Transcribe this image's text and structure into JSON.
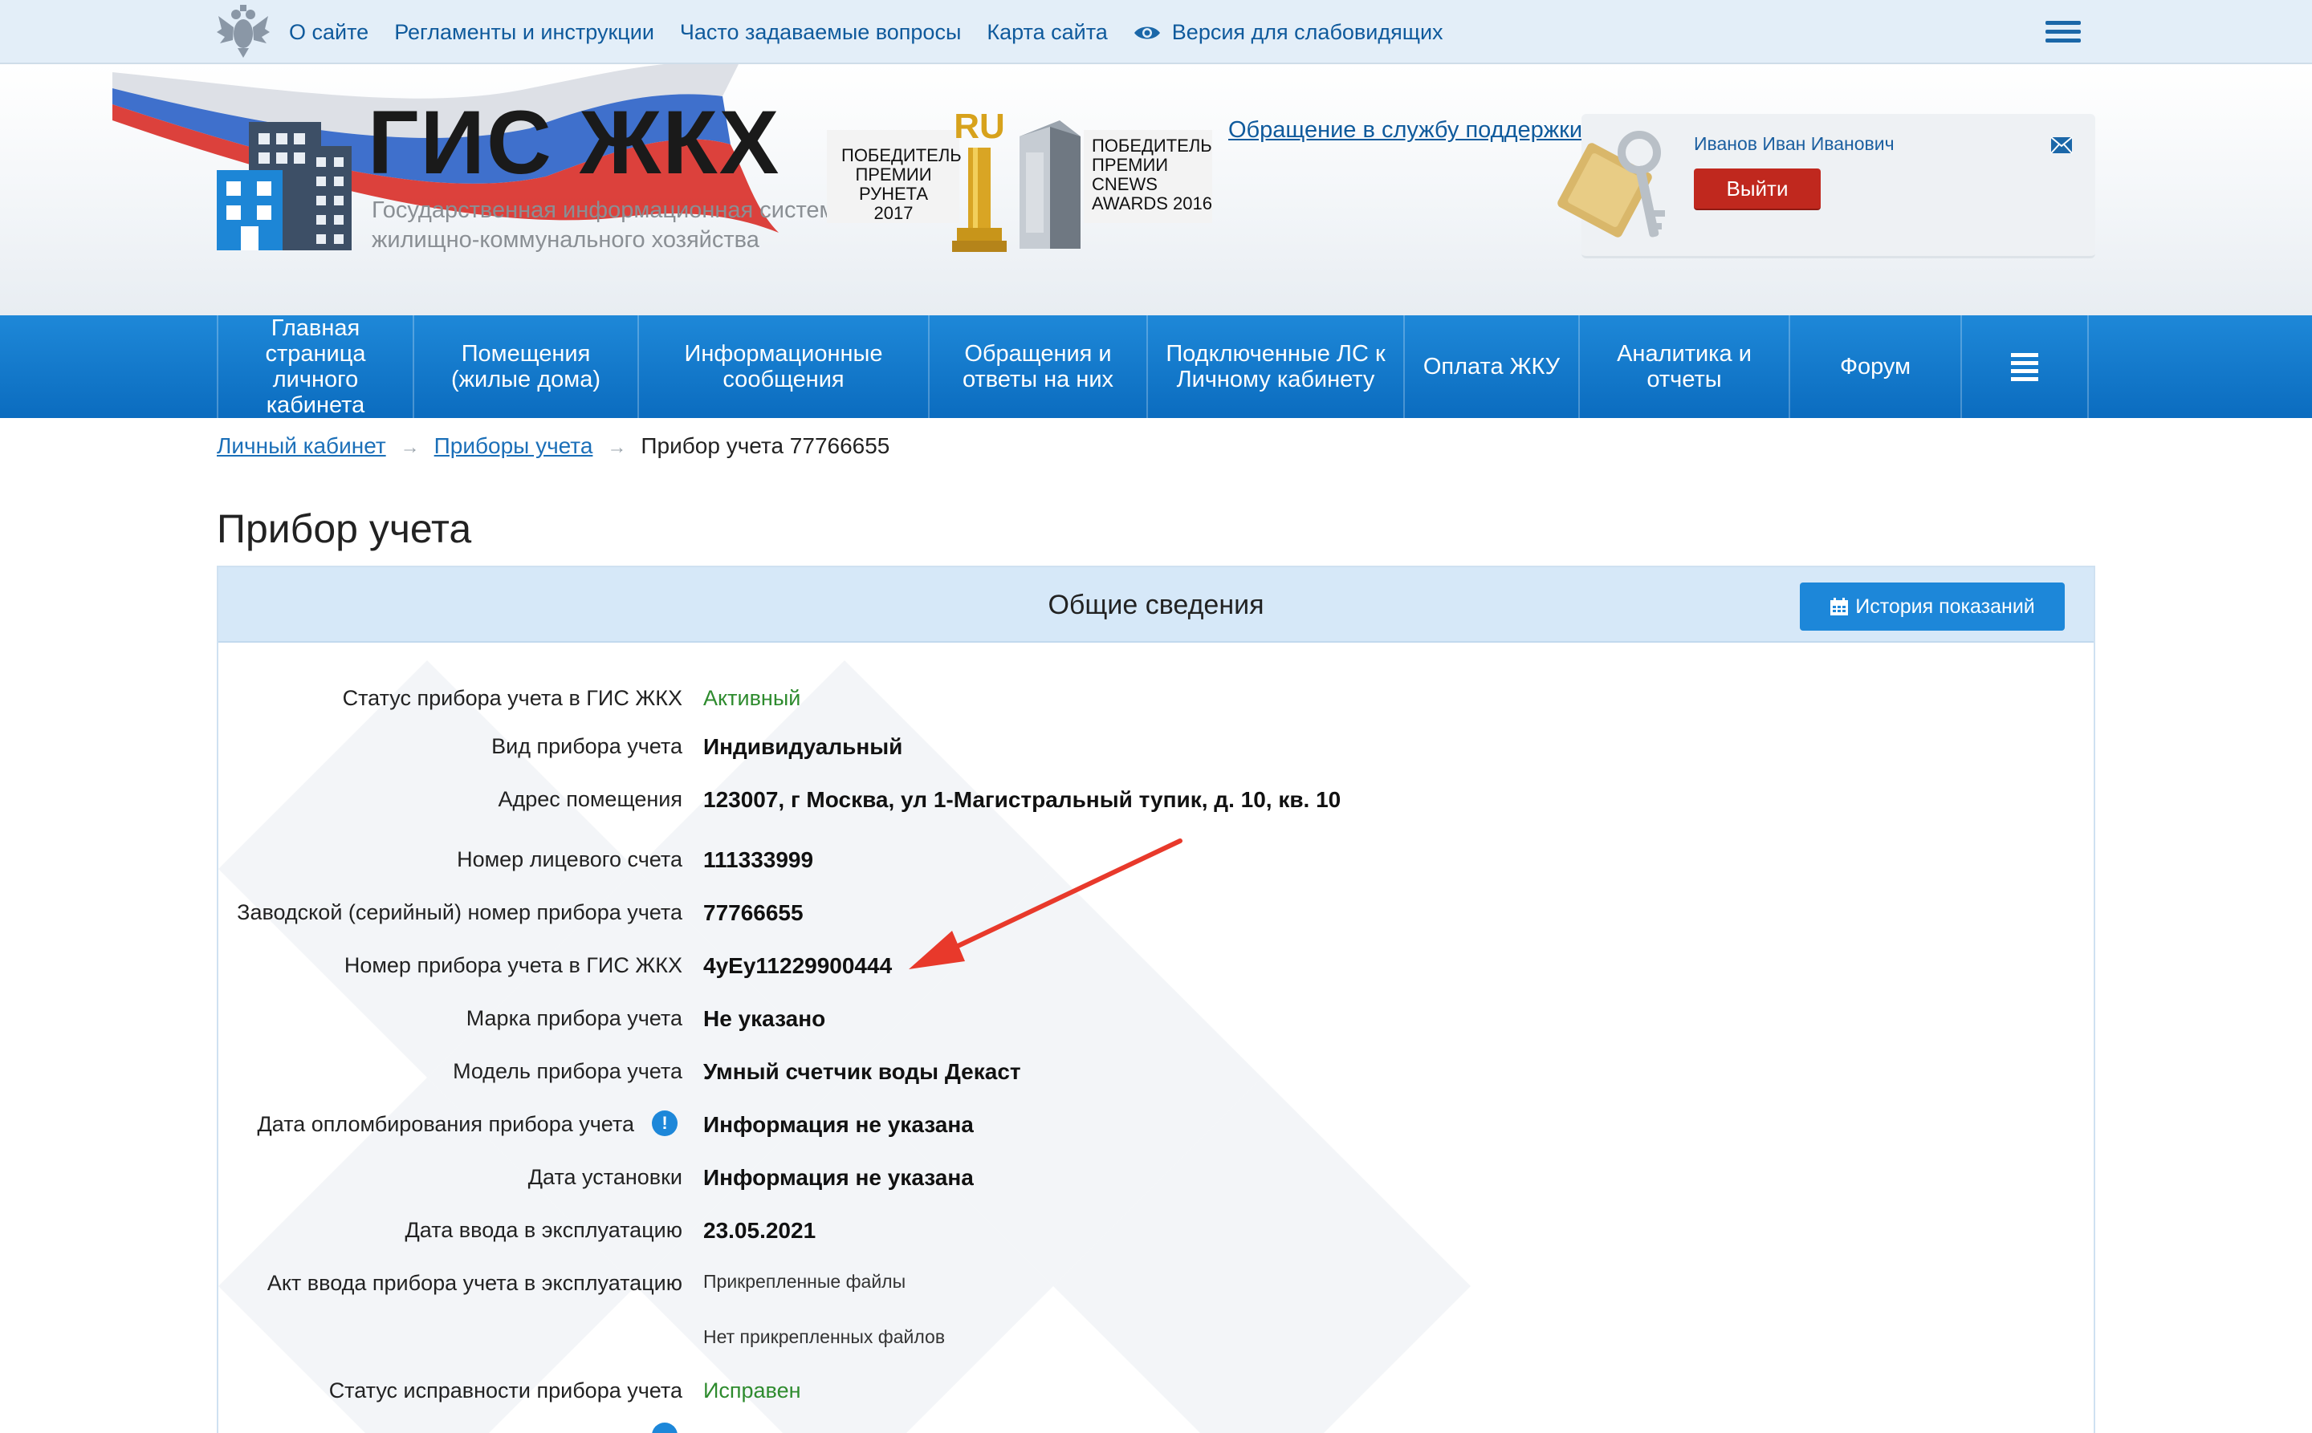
{
  "topbar": {
    "links": [
      "О сайте",
      "Регламенты и инструкции",
      "Часто задаваемые вопросы",
      "Карта сайта"
    ],
    "accessibility": "Версия для слабовидящих"
  },
  "header": {
    "logo_title": "ГИС ЖКХ",
    "logo_subtitle_line1": "Государственная информационная система",
    "logo_subtitle_line2": "жилищно-коммунального хозяйства",
    "award1_lines": [
      "ПОБЕДИТЕЛЬ",
      "ПРЕМИИ",
      "РУНЕТА 2017"
    ],
    "award2_lines": [
      "ПОБЕДИТЕЛЬ",
      "ПРЕМИИ",
      "CNEWS",
      "AWARDS 2016"
    ],
    "award_logo_text": "RU",
    "support_link": "Обращение в службу поддержки",
    "user_name": "Иванов Иван Иванович",
    "logout_label": "Выйти"
  },
  "nav": {
    "items": [
      "Главная страница личного кабинета",
      "Помещения (жилые дома)",
      "Информационные сообщения",
      "Обращения и ответы на них",
      "Подключенные ЛС к Личному кабинету",
      "Оплата ЖКУ",
      "Аналитика и отчеты",
      "Форум"
    ]
  },
  "breadcrumb": {
    "items": [
      "Личный кабинет",
      "Приборы учета"
    ],
    "separator": "→",
    "current": "Прибор учета 77766655"
  },
  "page_title": "Прибор учета",
  "card": {
    "title": "Общие сведения",
    "history_button": "История показаний",
    "rows": [
      {
        "label": "Статус прибора учета в ГИС ЖКХ",
        "value": "Активный"
      },
      {
        "label": "Вид прибора учета",
        "value": "Индивидуальный"
      },
      {
        "label": "Адрес помещения",
        "value": "123007, г Москва, ул 1-Магистральный тупик, д. 10, кв. 10"
      },
      {
        "label": "Номер лицевого счета",
        "value": "111333999"
      },
      {
        "label": "Заводской (серийный) номер прибора учета",
        "value": "77766655"
      },
      {
        "label": "Номер прибора учета в ГИС ЖКХ",
        "value": "4yEy11229900444"
      },
      {
        "label": "Марка прибора учета",
        "value": "Не указано"
      },
      {
        "label": "Модель прибора учета",
        "value": "Умный счетчик воды Декаст"
      },
      {
        "label": "Дата опломбирования прибора учета",
        "value": "Информация не указана",
        "info": "!"
      },
      {
        "label": "Дата установки",
        "value": "Информация не указана"
      },
      {
        "label": "Дата ввода в эксплуатацию",
        "value": "23.05.2021"
      },
      {
        "label": "Акт ввода прибора учета в эксплуатацию",
        "value": "Прикрепленные файлы",
        "extra": "Нет прикрепленных файлов"
      },
      {
        "label": "Статус исправности прибора учета",
        "value": "Исправен"
      }
    ]
  },
  "colors": {
    "nav_blue": "#0b6cbf",
    "link_blue": "#0f5a9c",
    "logout_red": "#c0281e",
    "status_green": "#2e8b2e",
    "annotation_arrow": "#e8392b"
  }
}
